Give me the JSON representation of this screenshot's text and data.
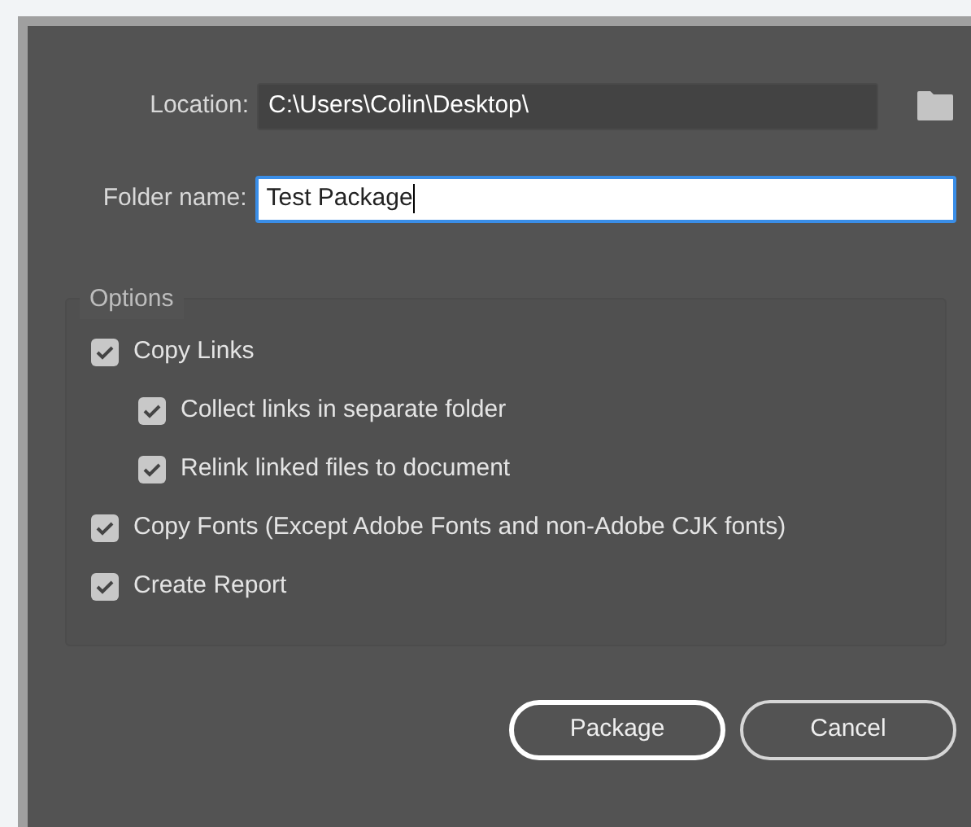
{
  "location": {
    "label": "Location:",
    "value": "C:\\Users\\Colin\\Desktop\\"
  },
  "folder_name": {
    "label": "Folder name:",
    "value": "Test Package"
  },
  "options": {
    "title": "Options",
    "items": [
      {
        "label": "Copy Links",
        "checked": true,
        "children": [
          {
            "label": "Collect links in separate folder",
            "checked": true
          },
          {
            "label": "Relink linked files to document",
            "checked": true
          }
        ]
      },
      {
        "label": "Copy Fonts (Except Adobe Fonts and non-Adobe CJK fonts)",
        "checked": true
      },
      {
        "label": "Create Report",
        "checked": true
      }
    ]
  },
  "buttons": [
    {
      "label": "Package",
      "selected": true
    },
    {
      "label": "Cancel",
      "selected": false
    }
  ]
}
